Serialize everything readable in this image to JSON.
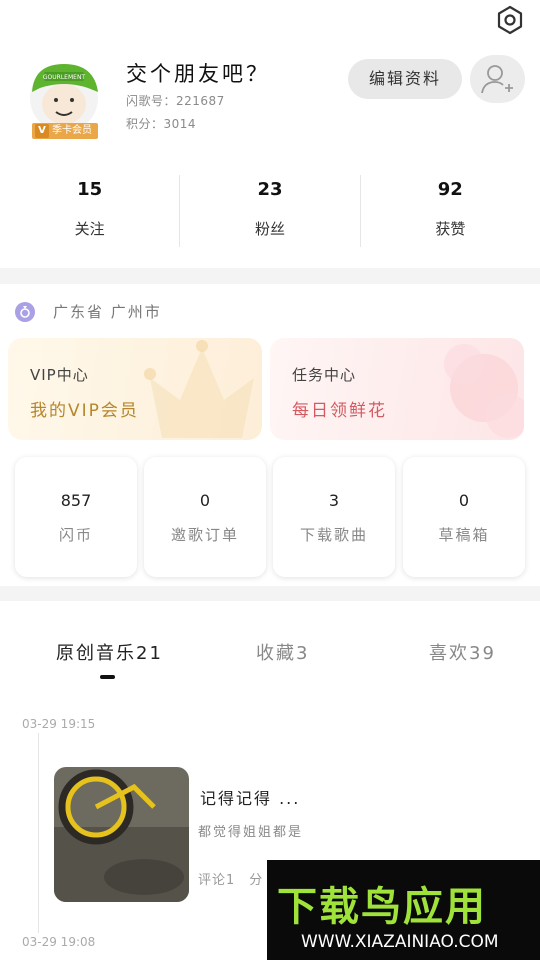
{
  "header": {
    "username": "交个朋友吧？",
    "id_line": "闪歌号：221687",
    "points_line": "积分：3014",
    "member_badge": "季卡会员",
    "member_letter": "V",
    "edit_button": "编辑资料",
    "avatar_hat_text": "GOURLEMENT"
  },
  "stats": [
    {
      "value": "15",
      "label": "关注"
    },
    {
      "value": "23",
      "label": "粉丝"
    },
    {
      "value": "92",
      "label": "获赞"
    }
  ],
  "location": "广东省 广州市",
  "promos": {
    "vip": {
      "title": "VIP中心",
      "subtitle": "我的VIP会员"
    },
    "task": {
      "title": "任务中心",
      "subtitle": "每日领鲜花"
    }
  },
  "tiles": [
    {
      "value": "857",
      "label": "闪币"
    },
    {
      "value": "0",
      "label": "邀歌订单"
    },
    {
      "value": "3",
      "label": "下载歌曲"
    },
    {
      "value": "0",
      "label": "草稿箱"
    }
  ],
  "tabs": [
    {
      "label": "原创音乐21"
    },
    {
      "label": "收藏3"
    },
    {
      "label": "喜欢39"
    }
  ],
  "feed": {
    "time1": "03-29 19:15",
    "time2": "03-29 19:08",
    "post_title": "记得记得 ...",
    "post_desc": "都觉得姐姐都是",
    "post_meta": "评论1　分"
  },
  "watermark": {
    "title": "下载鸟应用",
    "url": "WWW.XIAZAINIAO.COM"
  },
  "colors": {
    "vip_accent": "#b5862a",
    "task_accent": "#d45a62",
    "badge": "#e9a74a",
    "watermark_green": "#9ee23a"
  }
}
